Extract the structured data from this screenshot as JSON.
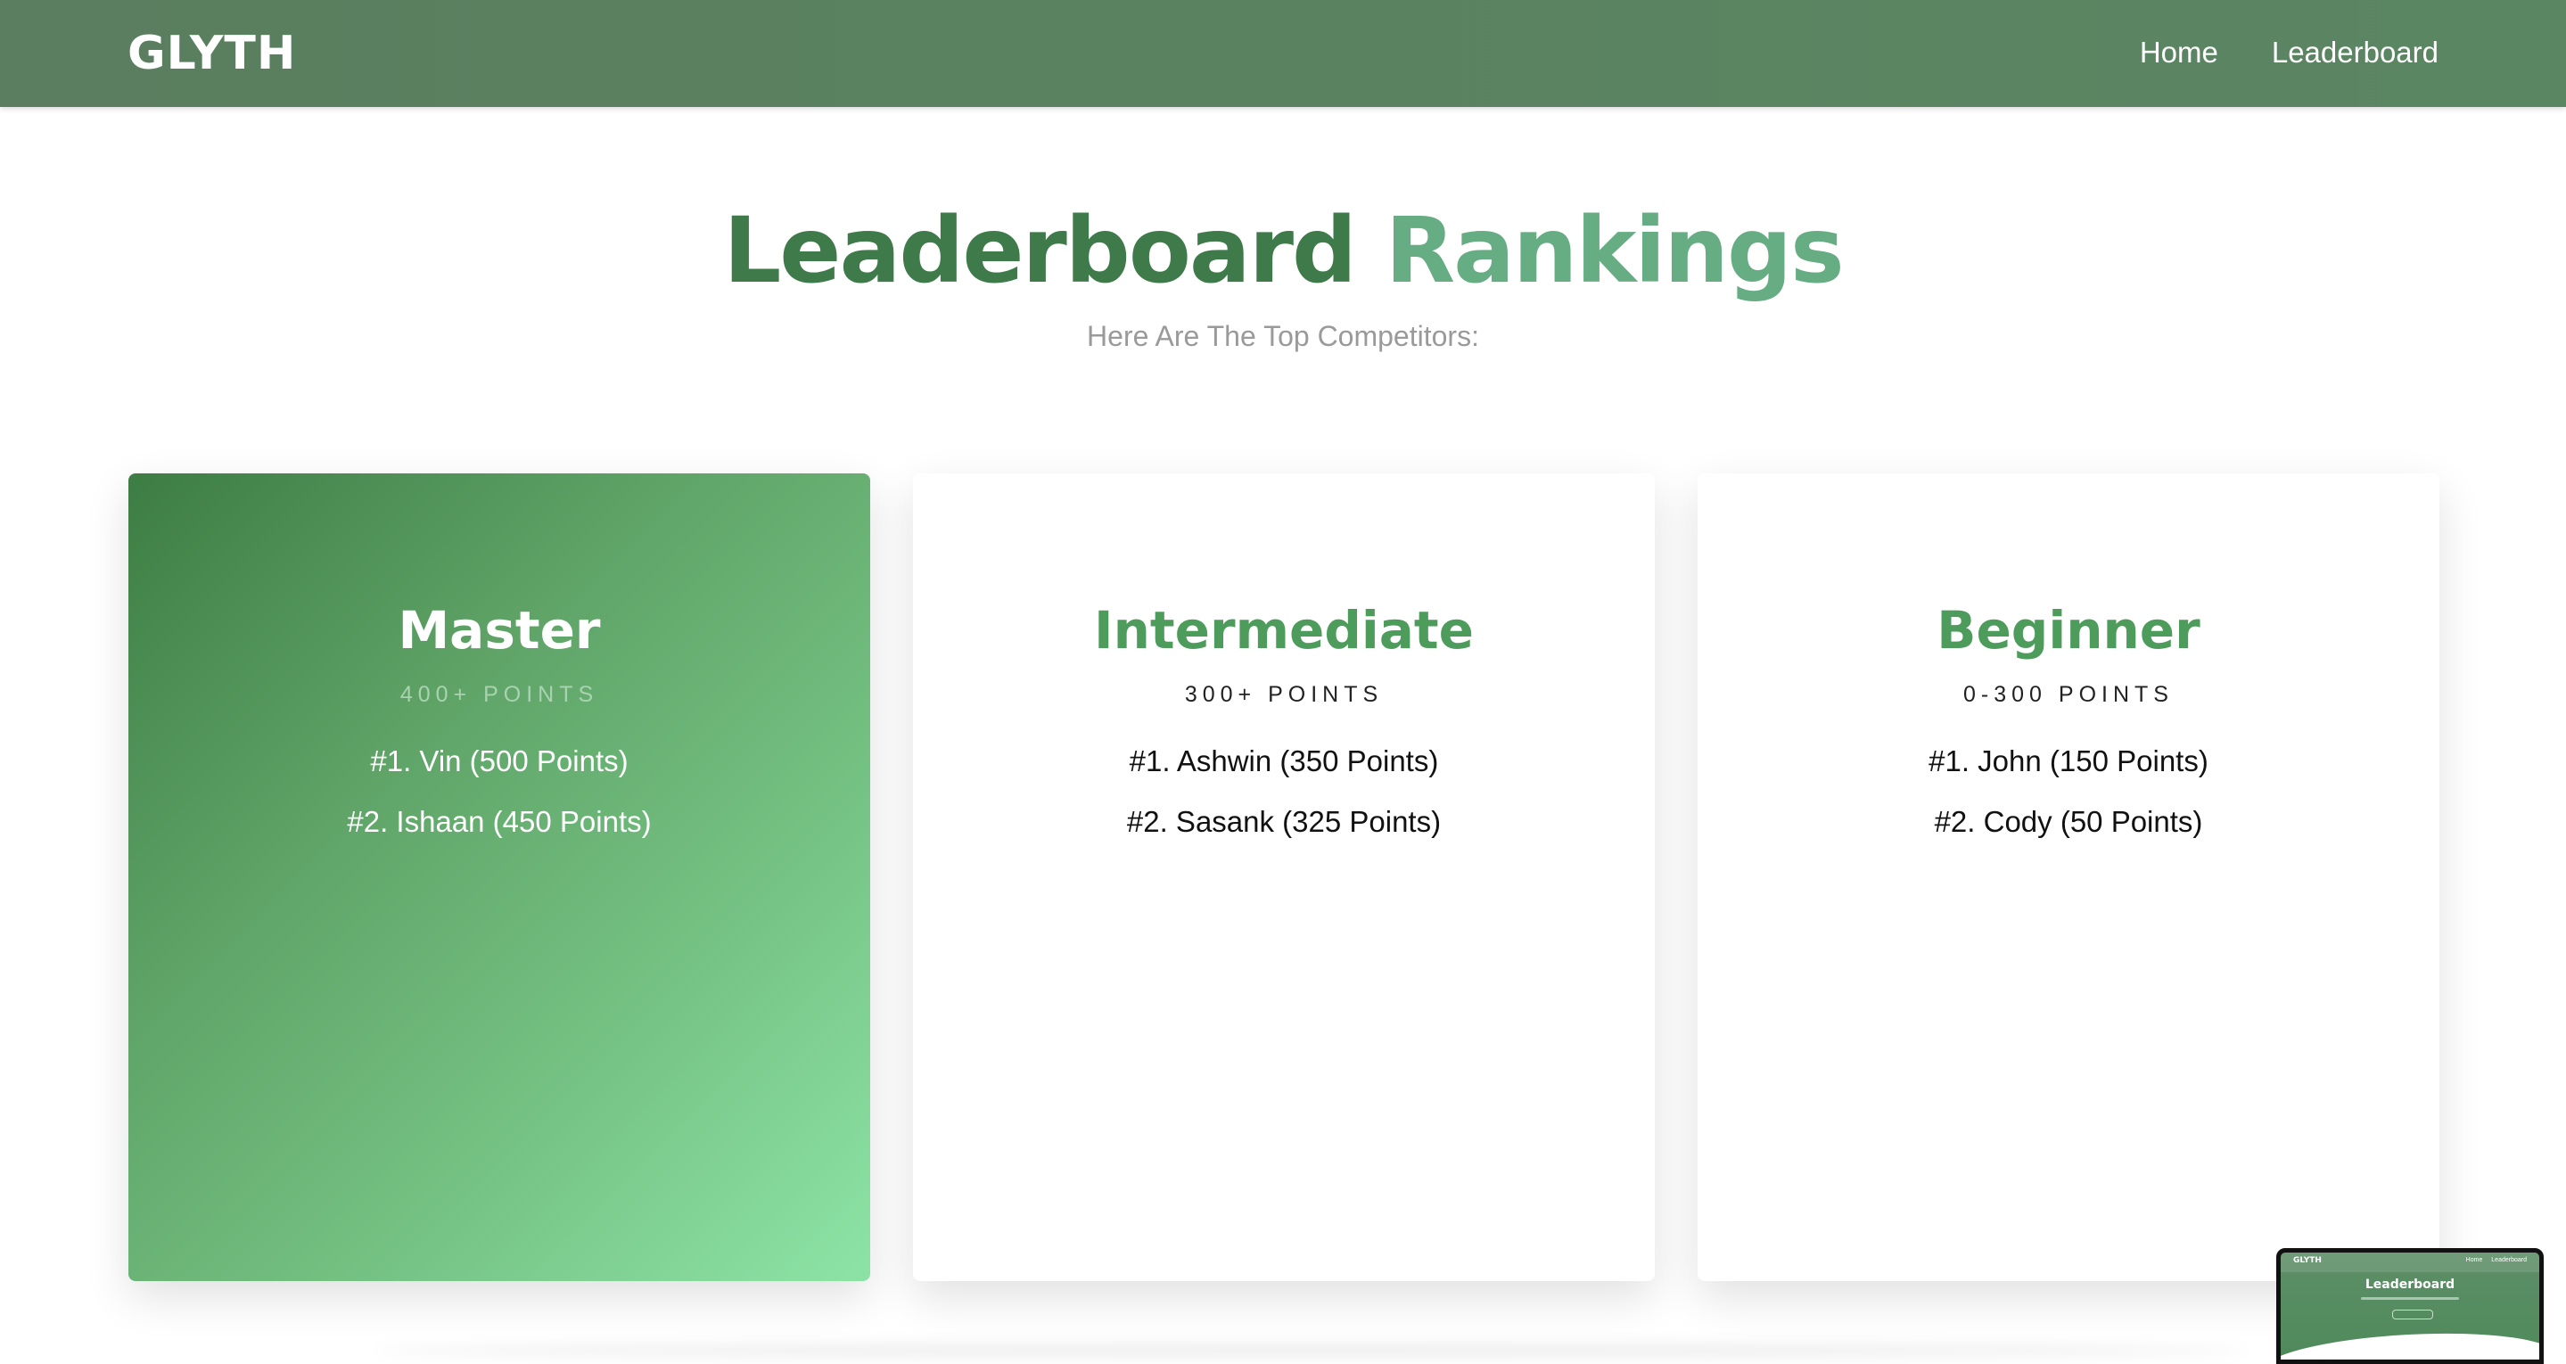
{
  "navbar": {
    "brand": "GLYTH",
    "links": [
      {
        "label": "Home"
      },
      {
        "label": "Leaderboard"
      }
    ]
  },
  "hero": {
    "title_word_1": "Leaderboard",
    "title_word_2": "Rankings",
    "subtitle": "Here Are The Top Competitors:"
  },
  "tiers": [
    {
      "name": "Master",
      "points": "400+ POINTS",
      "ranks": [
        "#1. Vin (500 Points)",
        "#2. Ishaan (450 Points)"
      ]
    },
    {
      "name": "Intermediate",
      "points": "300+ POINTS",
      "ranks": [
        "#1. Ashwin (350 Points)",
        "#2. Sasank (325 Points)"
      ]
    },
    {
      "name": "Beginner",
      "points": "0-300 POINTS",
      "ranks": [
        "#1. John (150 Points)",
        "#2. Cody (50 Points)"
      ]
    }
  ],
  "thumbnail": {
    "brand": "GLYTH",
    "links": "Home Leaderboard",
    "title": "Leaderboard"
  },
  "colors": {
    "navbar": "#5a7e5f",
    "title_dark": "#3f7a4a",
    "title_light": "#67ad84",
    "tier_green": "#4e9c5c",
    "master_gradient_start": "#3d7d43",
    "master_gradient_end": "#8de3a6"
  }
}
